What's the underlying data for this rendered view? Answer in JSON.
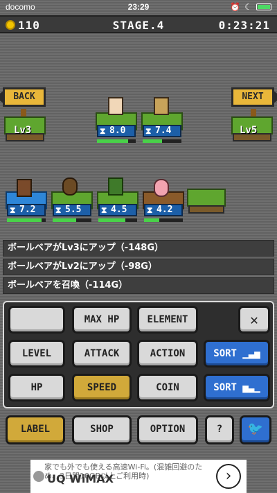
{
  "status_bar": {
    "carrier": "docomo",
    "time": "23:29"
  },
  "top_bar": {
    "coins": "110",
    "stage": "STAGE.4",
    "timer": "0:23:21"
  },
  "nav": {
    "back": "BACK",
    "next": "NEXT",
    "prev_level": "Lv3",
    "next_level": "Lv5"
  },
  "units_top": [
    {
      "speed": "8.0",
      "hp": 0.8
    },
    {
      "speed": "7.4",
      "hp": 0.5
    }
  ],
  "units_bottom": [
    {
      "speed": "7.2",
      "hp": 0.9
    },
    {
      "speed": "5.5",
      "hp": 0.6
    },
    {
      "speed": "4.5",
      "hp": 0.7
    },
    {
      "speed": "4.2",
      "hp": 0.4
    }
  ],
  "log": [
    "ボールベアがLv3にアップ（-148G）",
    "ボールベアがLv2にアップ（-98G）",
    "ボールベアを召喚（-114G）"
  ],
  "buttons": {
    "max_hp": "MAX HP",
    "element": "ELEMENT",
    "level": "LEVEL",
    "attack": "ATTACK",
    "action": "ACTION",
    "sort_asc": "SORT",
    "hp": "HP",
    "speed": "SPEED",
    "coin": "COIN",
    "sort_desc": "SORT",
    "label": "LABEL",
    "shop": "SHOP",
    "option": "OPTION",
    "help": "?"
  },
  "ad": {
    "text": "家でも外でも使える高速Wi-Fi。(混雑回避のため、3日間10GB以上ご利用時)",
    "brand": "UQ WiMAX"
  }
}
